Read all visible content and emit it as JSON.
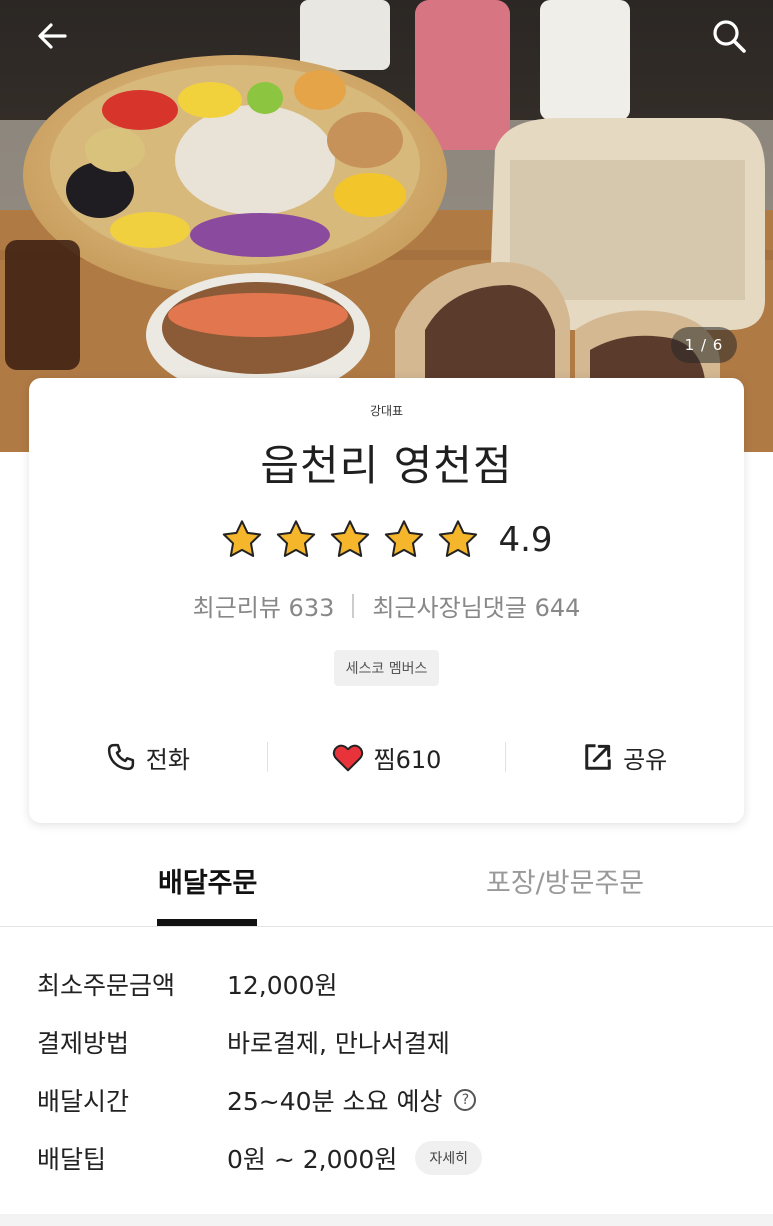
{
  "header": {
    "back_icon": "arrow-left-icon",
    "search_icon": "search-icon",
    "photo_pager": "1 / 6"
  },
  "store": {
    "owner": "강대표",
    "name": "읍천리 영천점",
    "rating": "4.9",
    "rating_value": 4.9,
    "stars_filled": 5,
    "star_color": "#f5b62b",
    "recent_reviews_label": "최근리뷰 633",
    "recent_owner_replies_label": "최근사장님댓글 644",
    "badge": "세스코 멤버스"
  },
  "actions": {
    "call_label": "전화",
    "wish_label": "찜610",
    "share_label": "공유",
    "heart_color": "#e8333b"
  },
  "tabs": {
    "delivery_label": "배달주문",
    "pickup_label": "포장/방문주문"
  },
  "info": {
    "min_order_label": "최소주문금액",
    "min_order_value": "12,000원",
    "payment_label": "결제방법",
    "payment_value": "바로결제, 만나서결제",
    "delivery_time_label": "배달시간",
    "delivery_time_value": "25~40분 소요 예상",
    "delivery_tip_label": "배달팁",
    "delivery_tip_value": "0원 ~ 2,000원",
    "detail_button": "자세히"
  }
}
